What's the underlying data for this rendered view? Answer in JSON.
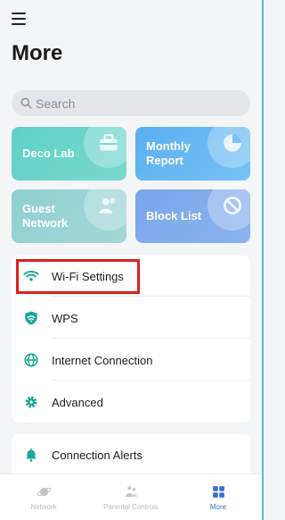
{
  "header": {
    "title": "More",
    "menu_icon": "hamburger-menu-icon"
  },
  "search": {
    "placeholder": "Search",
    "icon": "search-icon"
  },
  "tiles": [
    {
      "label": "Deco Lab",
      "icon": "toolbox-icon",
      "color": "#5fd0c6"
    },
    {
      "label": "Monthly Report",
      "icon": "pie-chart-icon",
      "color": "#5aaff0"
    },
    {
      "label": "Guest Network",
      "icon": "guests-icon",
      "color": "#8fcfd0"
    },
    {
      "label": "Block List",
      "icon": "block-icon",
      "color": "#7aa5ea"
    }
  ],
  "menu": [
    {
      "label": "Wi-Fi Settings",
      "icon": "wifi-icon"
    },
    {
      "label": "WPS",
      "icon": "wps-shield-icon"
    },
    {
      "label": "Internet Connection",
      "icon": "globe-icon"
    },
    {
      "label": "Advanced",
      "icon": "gear-icon"
    }
  ],
  "menu2": [
    {
      "label": "Connection Alerts",
      "icon": "bell-icon"
    }
  ],
  "tabbar": [
    {
      "label": "Network",
      "icon": "planet-icon",
      "active": false
    },
    {
      "label": "Parental Controls",
      "icon": "family-icon",
      "active": false
    },
    {
      "label": "More",
      "icon": "grid-icon",
      "active": true
    }
  ],
  "colors": {
    "accent": "#3a6fd9",
    "teal": "#1aa89b",
    "highlight": "#e01e1e"
  }
}
